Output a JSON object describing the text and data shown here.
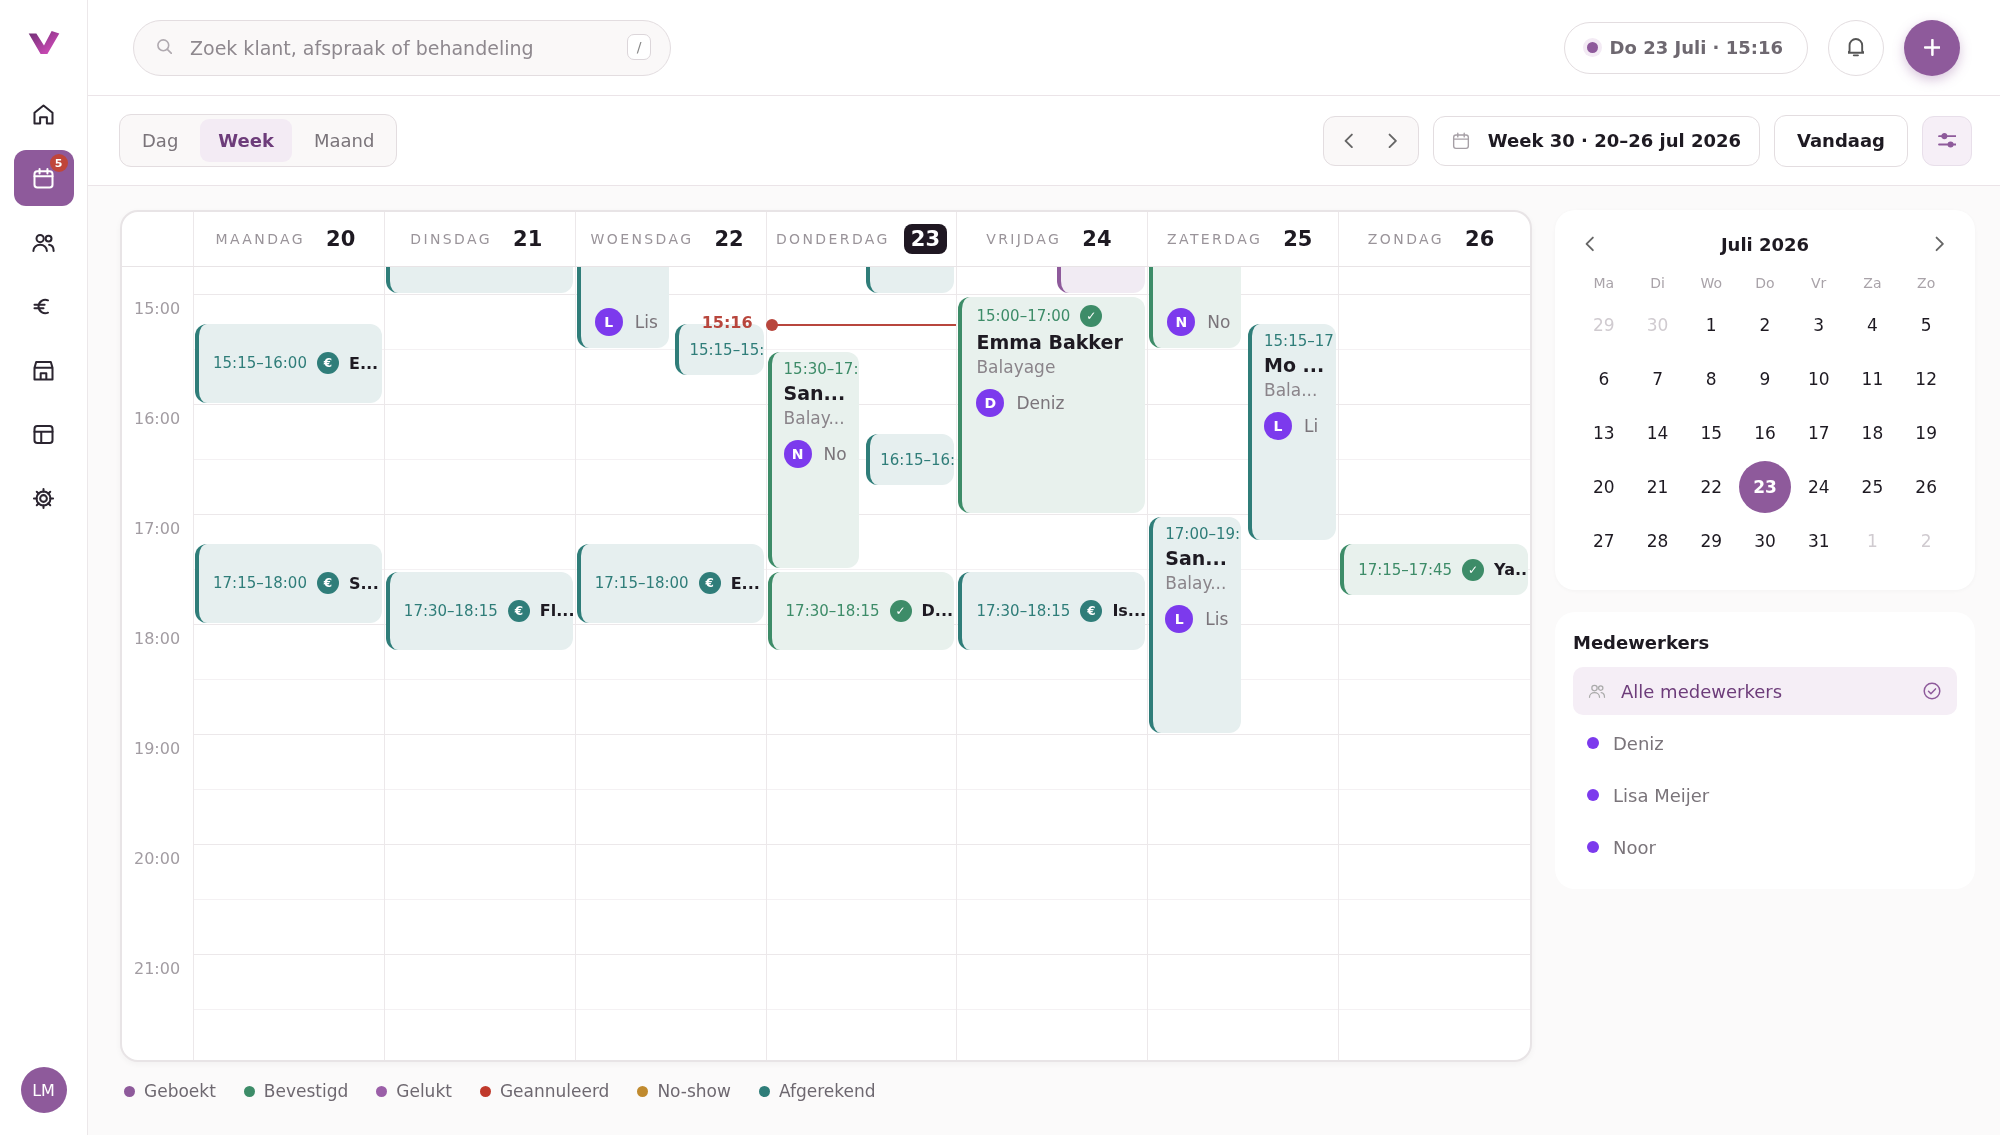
{
  "sidebar": {
    "items": [
      {
        "selected": false
      },
      {
        "selected": true,
        "badge": "5"
      },
      {
        "selected": false
      },
      {
        "selected": false
      },
      {
        "selected": false
      },
      {
        "selected": false
      },
      {
        "selected": false
      }
    ],
    "user": {
      "initials": "LM"
    }
  },
  "search": {
    "placeholder": "Zoek klant, afspraak of behandeling",
    "shortcut": "/"
  },
  "clock": {
    "text": "Do 23 Juli · 15:16"
  },
  "view_tabs": [
    {
      "label": "Dag",
      "selected": false
    },
    {
      "label": "Week",
      "selected": true
    },
    {
      "label": "Maand",
      "selected": false
    }
  ],
  "week_button": {
    "label": "Week 30 · 20–26 jul 2026"
  },
  "today_button": {
    "label": "Vandaag"
  },
  "calendar": {
    "hours": [
      "15:00",
      "16:00",
      "17:00",
      "18:00",
      "19:00",
      "20:00",
      "21:00"
    ],
    "days": [
      {
        "weekday": "MAANDAG",
        "date": "20",
        "today": false,
        "events": [
          {
            "kind": "compact",
            "color": "#2f7d79",
            "time": "15:15–16:00",
            "badge": "€",
            "name": "E..."
          },
          {
            "kind": "compact",
            "color": "#2f7d79",
            "time": "17:15–18:00",
            "badge": "€",
            "name": "S..."
          }
        ]
      },
      {
        "weekday": "DINSDAG",
        "date": "21",
        "today": false,
        "events": [
          {
            "kind": "blank",
            "color": "#2f7d79"
          },
          {
            "kind": "compact",
            "color": "#2f7d79",
            "time": "17:30–18:15",
            "badge": "€",
            "name": "Fl..."
          }
        ]
      },
      {
        "weekday": "WOENSDAG",
        "date": "22",
        "today": false,
        "events": [
          {
            "kind": "tail",
            "color": "#2f7d79",
            "staff": {
              "initial": "L",
              "name": "Lis"
            }
          },
          {
            "kind": "compact",
            "color": "#2f7d79",
            "time": "15:15–15:"
          },
          {
            "kind": "compact",
            "color": "#2f7d79",
            "time": "17:15–18:00",
            "badge": "€",
            "name": "E..."
          }
        ]
      },
      {
        "weekday": "DONDERDAG",
        "date": "23",
        "today": true,
        "now": "15:16",
        "events": [
          {
            "kind": "blank",
            "color": "#2f7d79"
          },
          {
            "kind": "detail",
            "color": "#3d8c68",
            "time": "15:30–17:",
            "name": "San...",
            "service": "Balay...",
            "staff": {
              "initial": "N",
              "name": "No"
            }
          },
          {
            "kind": "compact",
            "color": "#2f7d79",
            "time": "16:15–16:"
          },
          {
            "kind": "compact",
            "color": "#3d8c68",
            "time": "17:30–18:15",
            "badge": "✓",
            "name": "D..."
          }
        ]
      },
      {
        "weekday": "VRIJDAG",
        "date": "24",
        "today": false,
        "events": [
          {
            "kind": "blank",
            "color": "#8e5a9b"
          },
          {
            "kind": "detail",
            "color": "#3d8c68",
            "time": "15:00–17:00",
            "badge": "✓",
            "name": "Emma Bakker",
            "service": "Balayage",
            "staff": {
              "initial": "D",
              "name": "Deniz"
            }
          },
          {
            "kind": "compact",
            "color": "#2f7d79",
            "time": "17:30–18:15",
            "badge": "€",
            "name": "Is..."
          }
        ]
      },
      {
        "weekday": "ZATERDAG",
        "date": "25",
        "today": false,
        "events": [
          {
            "kind": "tail",
            "color": "#3d8c68",
            "staff": {
              "initial": "N",
              "name": "No"
            }
          },
          {
            "kind": "detail",
            "color": "#2f7d79",
            "time": "15:15–17",
            "name": "Mo ...",
            "service": "Bala...",
            "staff": {
              "initial": "L",
              "name": "Li"
            }
          },
          {
            "kind": "detail",
            "color": "#2f7d79",
            "time": "17:00–19:",
            "name": "San...",
            "service": "Balay...",
            "staff": {
              "initial": "L",
              "name": "Lis"
            }
          }
        ]
      },
      {
        "weekday": "ZONDAG",
        "date": "26",
        "today": false,
        "events": [
          {
            "kind": "compact",
            "color": "#3d8c68",
            "time": "17:15–17:45",
            "badge": "✓",
            "name": "Ya..."
          }
        ]
      }
    ]
  },
  "legend": [
    {
      "label": "Geboekt",
      "color": "#8e5a9b"
    },
    {
      "label": "Bevestigd",
      "color": "#3d8c68"
    },
    {
      "label": "Gelukt",
      "color": "#9b5fa8"
    },
    {
      "label": "Geannuleerd",
      "color": "#c0392b"
    },
    {
      "label": "No-show",
      "color": "#c08a2e"
    },
    {
      "label": "Afgerekend",
      "color": "#2f7d79"
    }
  ],
  "mini_calendar": {
    "title": "Juli 2026",
    "weekdays": [
      "Ma",
      "Di",
      "Wo",
      "Do",
      "Vr",
      "Za",
      "Zo"
    ],
    "days": [
      {
        "label": "29",
        "muted": true,
        "selected": false
      },
      {
        "label": "30",
        "muted": true,
        "selected": false
      },
      {
        "label": "1",
        "muted": false,
        "selected": false
      },
      {
        "label": "2",
        "muted": false,
        "selected": false
      },
      {
        "label": "3",
        "muted": false,
        "selected": false
      },
      {
        "label": "4",
        "muted": false,
        "selected": false
      },
      {
        "label": "5",
        "muted": false,
        "selected": false
      },
      {
        "label": "6",
        "muted": false,
        "selected": false
      },
      {
        "label": "7",
        "muted": false,
        "selected": false
      },
      {
        "label": "8",
        "muted": false,
        "selected": false
      },
      {
        "label": "9",
        "muted": false,
        "selected": false
      },
      {
        "label": "10",
        "muted": false,
        "selected": false
      },
      {
        "label": "11",
        "muted": false,
        "selected": false
      },
      {
        "label": "12",
        "muted": false,
        "selected": false
      },
      {
        "label": "13",
        "muted": false,
        "selected": false
      },
      {
        "label": "14",
        "muted": false,
        "selected": false
      },
      {
        "label": "15",
        "muted": false,
        "selected": false
      },
      {
        "label": "16",
        "muted": false,
        "selected": false
      },
      {
        "label": "17",
        "muted": false,
        "selected": false
      },
      {
        "label": "18",
        "muted": false,
        "selected": false
      },
      {
        "label": "19",
        "muted": false,
        "selected": false
      },
      {
        "label": "20",
        "muted": false,
        "selected": false
      },
      {
        "label": "21",
        "muted": false,
        "selected": false
      },
      {
        "label": "22",
        "muted": false,
        "selected": false
      },
      {
        "label": "23",
        "muted": false,
        "selected": true
      },
      {
        "label": "24",
        "muted": false,
        "selected": false
      },
      {
        "label": "25",
        "muted": false,
        "selected": false
      },
      {
        "label": "26",
        "muted": false,
        "selected": false
      },
      {
        "label": "27",
        "muted": false,
        "selected": false
      },
      {
        "label": "28",
        "muted": false,
        "selected": false
      },
      {
        "label": "29",
        "muted": false,
        "selected": false
      },
      {
        "label": "30",
        "muted": false,
        "selected": false
      },
      {
        "label": "31",
        "muted": false,
        "selected": false
      },
      {
        "label": "1",
        "muted": true,
        "selected": false
      },
      {
        "label": "2",
        "muted": true,
        "selected": false
      }
    ]
  },
  "staff_panel": {
    "title": "Medewerkers",
    "items": [
      {
        "kind": "all",
        "label": "Alle medewerkers",
        "selected": true
      },
      {
        "kind": "person",
        "label": "Deniz",
        "selected": false,
        "color": "#7c3aed"
      },
      {
        "kind": "person",
        "label": "Lisa Meijer",
        "selected": false,
        "color": "#7c3aed"
      },
      {
        "kind": "person",
        "label": "Noor",
        "selected": false,
        "color": "#7c3aed"
      }
    ]
  }
}
